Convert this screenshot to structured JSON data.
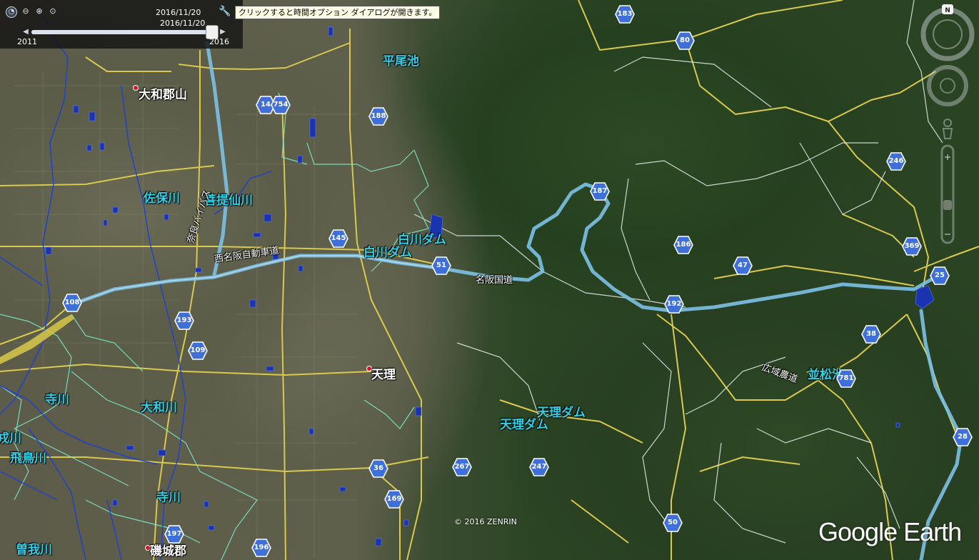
{
  "timebar": {
    "date_top": "2016/11/20",
    "date_slider": "2016/11/20",
    "year_start": "2011",
    "year_end": "2016",
    "slider_position": 0.96
  },
  "tooltip": "クリックすると時間オプション ダイアログが開きます。",
  "nav": {
    "north_label": "N"
  },
  "places": {
    "yamatokoriyama": "大和郡山",
    "tenri": "天理",
    "shiki": "磯城郡"
  },
  "water_labels": {
    "hirao_ike": "平尾池",
    "saho_gawa": "佐保川",
    "bodaisen_gawa": "菩提仙川",
    "shirakawa_dam_1": "白川ダム",
    "shirakawa_dam_2": "白川ダム",
    "tenri_dam_1": "天理ダム",
    "tenri_dam_2": "天理ダム",
    "namimatsu_ike": "並松池",
    "tera_gawa_1": "寺川",
    "yamato_gawa": "大和川",
    "tera_gawa_2": "寺川",
    "asuka_gawa": "飛鳥川",
    "soga_gawa": "曽我川",
    "left_edge_river": "戎川"
  },
  "road_labels": {
    "nishimeihan": "西名阪自動車道",
    "nara_bypass": "奈良バイパス",
    "meihan_kokudo": "名阪国道",
    "koiki_nodo": "広域農道"
  },
  "route_shields": [
    "183",
    "80",
    "14",
    "754",
    "188",
    "246",
    "187",
    "145",
    "51",
    "186",
    "47",
    "369",
    "25",
    "192",
    "108",
    "193",
    "109",
    "38",
    "781",
    "28",
    "36",
    "267",
    "247",
    "169",
    "197",
    "196",
    "50"
  ],
  "copyright": "© 2016 ZENRIN",
  "logo": "Google Earth"
}
